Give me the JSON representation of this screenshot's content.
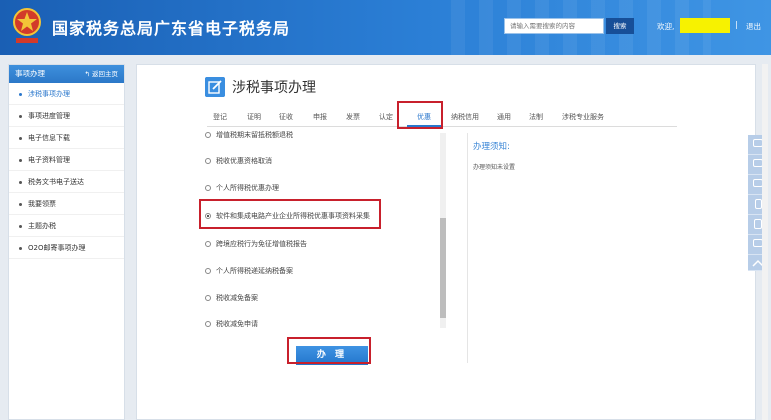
{
  "header": {
    "title": "国家税务总局广东省电子税务局",
    "search_placeholder": "请输入需要搜索的内容",
    "search_button": "搜索",
    "welcome": "欢迎,",
    "separator": "|",
    "logout": "退出"
  },
  "sidebar": {
    "title": "事项办理",
    "back_label": "返回主页",
    "items": [
      {
        "label": "涉税事项办理"
      },
      {
        "label": "事项进度管理"
      },
      {
        "label": "电子信息下载"
      },
      {
        "label": "电子资料管理"
      },
      {
        "label": "税务文书电子送达"
      },
      {
        "label": "我要领票"
      },
      {
        "label": "主题办税"
      },
      {
        "label": "O2O邮寄事项办理"
      }
    ]
  },
  "main": {
    "title": "涉税事项办理",
    "tabs": [
      {
        "label": "登记"
      },
      {
        "label": "证明"
      },
      {
        "label": "征收"
      },
      {
        "label": "申报"
      },
      {
        "label": "发票"
      },
      {
        "label": "认定"
      },
      {
        "label": "优惠"
      },
      {
        "label": "纳税信用"
      },
      {
        "label": "通用"
      },
      {
        "label": "法制"
      },
      {
        "label": "涉税专业服务"
      }
    ],
    "active_tab": "优惠",
    "options": [
      {
        "label": "增值税期末留抵税额退税",
        "checked": false
      },
      {
        "label": "税收优惠资格取消",
        "checked": false
      },
      {
        "label": "个人所得税优惠办理",
        "checked": false
      },
      {
        "label": "软件和集成电路产业企业所得税优惠事项资料采集",
        "checked": true
      },
      {
        "label": "跨境应税行为免征增值税报告",
        "checked": false
      },
      {
        "label": "个人所得税递延纳税备案",
        "checked": false
      },
      {
        "label": "税收减免备案",
        "checked": false
      },
      {
        "label": "税收减免申请",
        "checked": false
      }
    ],
    "notice_title": "办理须知:",
    "notice_text": "办理须知未设置",
    "submit_label": "办 理"
  },
  "colors": {
    "header_blue": "#1a5fb4",
    "accent_blue": "#2a77cc",
    "highlight_red": "#c8202c",
    "user_mask_yellow": "#f7f200"
  }
}
